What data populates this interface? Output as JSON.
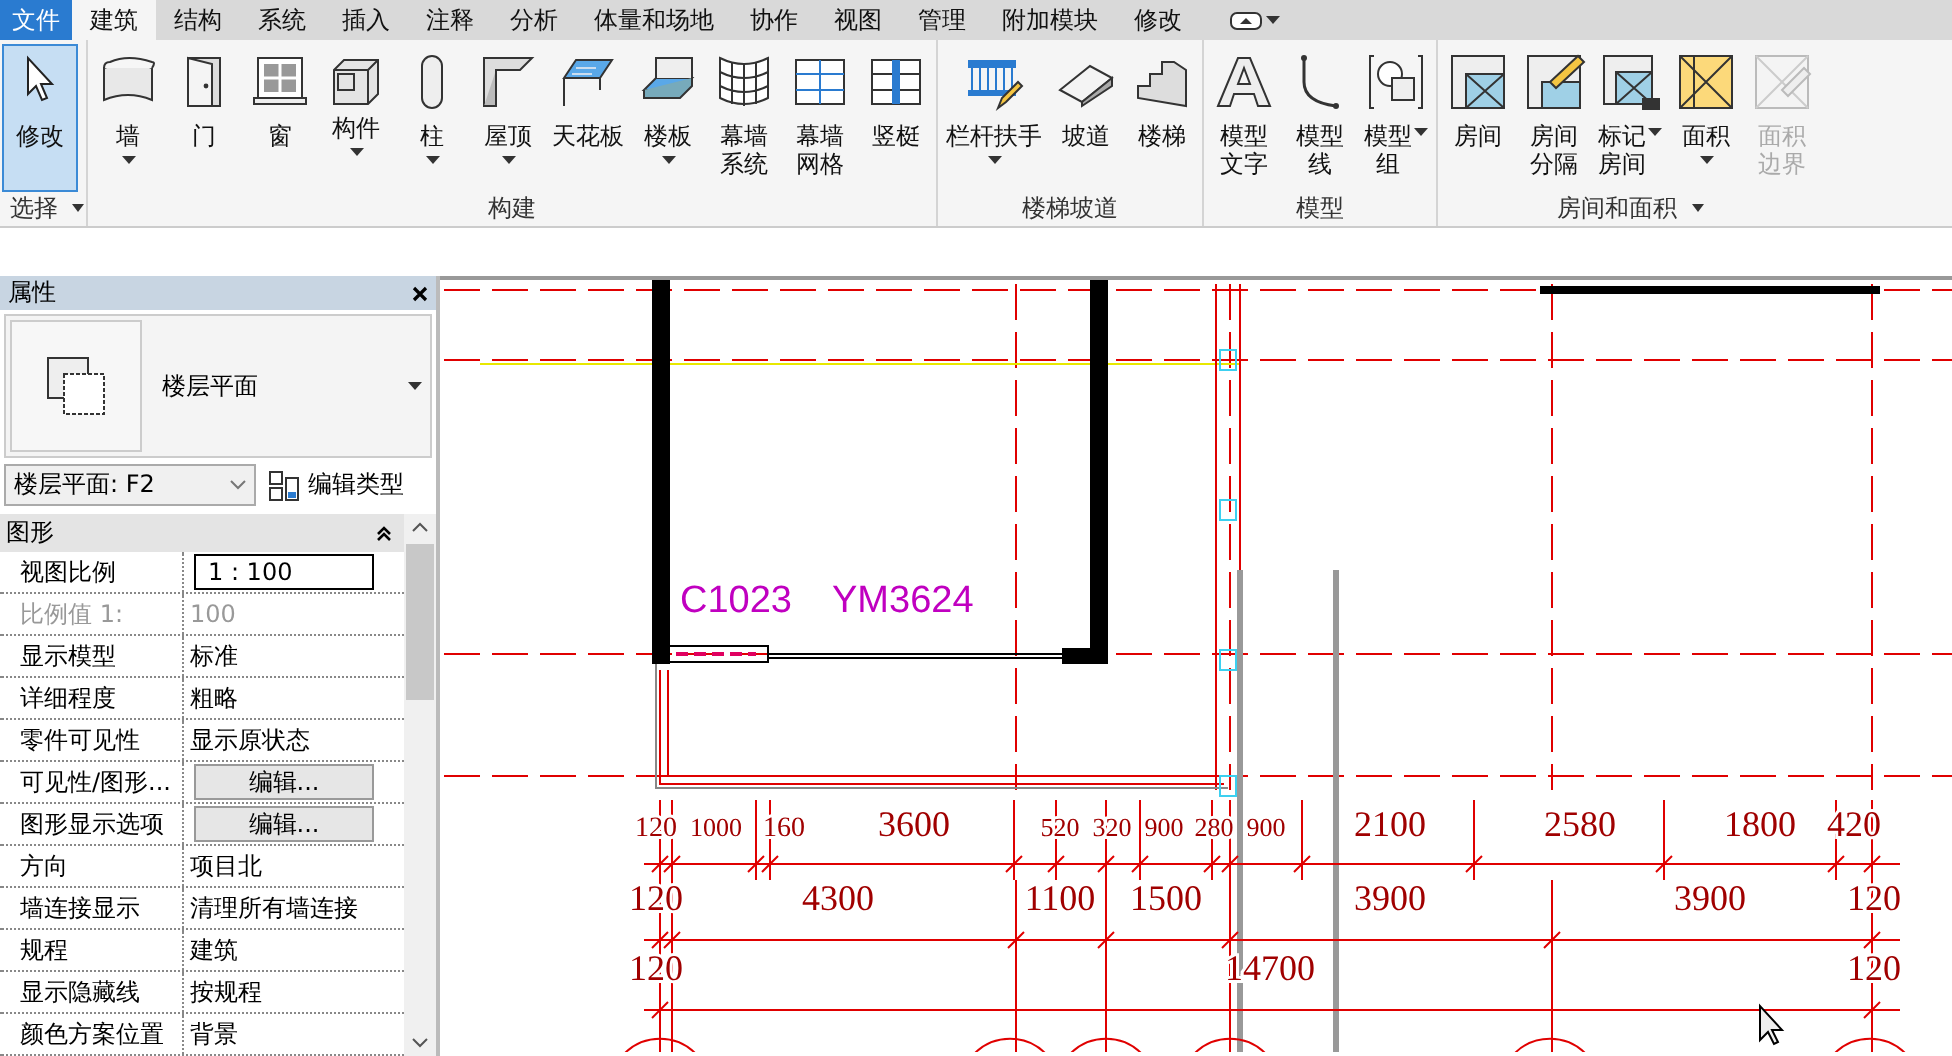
{
  "menu_tabs": [
    {
      "label": "文件",
      "kind": "app",
      "selected": false
    },
    {
      "label": "建筑",
      "kind": "tab",
      "selected": true
    },
    {
      "label": "结构",
      "kind": "tab",
      "selected": false
    },
    {
      "label": "系统",
      "kind": "tab",
      "selected": false
    },
    {
      "label": "插入",
      "kind": "tab",
      "selected": false
    },
    {
      "label": "注释",
      "kind": "tab",
      "selected": false
    },
    {
      "label": "分析",
      "kind": "tab",
      "selected": false
    },
    {
      "label": "体量和场地",
      "kind": "tab",
      "selected": false
    },
    {
      "label": "协作",
      "kind": "tab",
      "selected": false
    },
    {
      "label": "视图",
      "kind": "tab",
      "selected": false
    },
    {
      "label": "管理",
      "kind": "tab",
      "selected": false
    },
    {
      "label": "附加模块",
      "kind": "tab",
      "selected": false
    },
    {
      "label": "修改",
      "kind": "tab",
      "selected": false
    }
  ],
  "ribbon": {
    "panels": [
      {
        "title": "选择",
        "has_menu": true,
        "tools": [
          {
            "label_lines": [
              "修改"
            ],
            "dropdown": false,
            "selected": true,
            "disabled": false
          }
        ]
      },
      {
        "title": "构建",
        "has_menu": false,
        "tools": [
          {
            "label_lines": [
              "墙"
            ],
            "dropdown": true,
            "selected": false,
            "disabled": false
          },
          {
            "label_lines": [
              "门"
            ],
            "dropdown": false,
            "selected": false,
            "disabled": false
          },
          {
            "label_lines": [
              "窗"
            ],
            "dropdown": false,
            "selected": false,
            "disabled": false
          },
          {
            "label_lines": [
              "构件"
            ],
            "dropdown": true,
            "selected": false,
            "disabled": false
          },
          {
            "label_lines": [
              "柱"
            ],
            "dropdown": true,
            "selected": false,
            "disabled": false
          },
          {
            "label_lines": [
              "屋顶"
            ],
            "dropdown": true,
            "selected": false,
            "disabled": false
          },
          {
            "label_lines": [
              "天花板"
            ],
            "dropdown": false,
            "selected": false,
            "disabled": false
          },
          {
            "label_lines": [
              "楼板"
            ],
            "dropdown": true,
            "selected": false,
            "disabled": false
          },
          {
            "label_lines": [
              "幕墙",
              "系统"
            ],
            "dropdown": false,
            "selected": false,
            "disabled": false
          },
          {
            "label_lines": [
              "幕墙",
              "网格"
            ],
            "dropdown": false,
            "selected": false,
            "disabled": false
          },
          {
            "label_lines": [
              "竖梃"
            ],
            "dropdown": false,
            "selected": false,
            "disabled": false
          }
        ]
      },
      {
        "title": "楼梯坡道",
        "has_menu": false,
        "tools": [
          {
            "label_lines": [
              "栏杆扶手"
            ],
            "dropdown": true,
            "selected": false,
            "disabled": false
          },
          {
            "label_lines": [
              "坡道"
            ],
            "dropdown": false,
            "selected": false,
            "disabled": false
          },
          {
            "label_lines": [
              "楼梯"
            ],
            "dropdown": false,
            "selected": false,
            "disabled": false
          }
        ]
      },
      {
        "title": "模型",
        "has_menu": false,
        "tools": [
          {
            "label_lines": [
              "模型",
              "文字"
            ],
            "dropdown": false,
            "selected": false,
            "disabled": false
          },
          {
            "label_lines": [
              "模型",
              "线"
            ],
            "dropdown": false,
            "selected": false,
            "disabled": false
          },
          {
            "label_lines": [
              "模型",
              "组"
            ],
            "dropdown": true,
            "selected": false,
            "disabled": false
          }
        ]
      },
      {
        "title": "房间和面积",
        "has_menu": true,
        "tools": [
          {
            "label_lines": [
              "房间"
            ],
            "dropdown": false,
            "selected": false,
            "disabled": false
          },
          {
            "label_lines": [
              "房间",
              "分隔"
            ],
            "dropdown": false,
            "selected": false,
            "disabled": false
          },
          {
            "label_lines": [
              "标记",
              "房间"
            ],
            "dropdown": true,
            "selected": false,
            "disabled": false
          },
          {
            "label_lines": [
              "面积"
            ],
            "dropdown": true,
            "selected": false,
            "disabled": false
          },
          {
            "label_lines": [
              "面积",
              "边界"
            ],
            "dropdown": false,
            "selected": false,
            "disabled": true
          }
        ]
      }
    ]
  },
  "properties": {
    "title": "属性",
    "type_name": "楼层平面",
    "instance": "楼层平面: F2",
    "edit_type": "编辑类型",
    "group": {
      "title": "图形",
      "expanded": true
    },
    "rows": [
      {
        "name": "视图比例",
        "value": "1 : 100",
        "kind": "field",
        "disabled": false
      },
      {
        "name": "比例值 1:",
        "value": "100",
        "kind": "text",
        "disabled": true
      },
      {
        "name": "显示模型",
        "value": "标准",
        "kind": "text",
        "disabled": false
      },
      {
        "name": "详细程度",
        "value": "粗略",
        "kind": "text",
        "disabled": false
      },
      {
        "name": "零件可见性",
        "value": "显示原状态",
        "kind": "text",
        "disabled": false
      },
      {
        "name": "可见性/图形...",
        "value": "编辑...",
        "kind": "button",
        "disabled": false
      },
      {
        "name": "图形显示选项",
        "value": "编辑...",
        "kind": "button",
        "disabled": false
      },
      {
        "name": "方向",
        "value": "项目北",
        "kind": "text",
        "disabled": false
      },
      {
        "name": "墙连接显示",
        "value": "清理所有墙连接",
        "kind": "text",
        "disabled": false
      },
      {
        "name": "规程",
        "value": "建筑",
        "kind": "text",
        "disabled": false
      },
      {
        "name": "显示隐藏线",
        "value": "按规程",
        "kind": "text",
        "disabled": false
      },
      {
        "name": "颜色方案位置",
        "value": "背景",
        "kind": "text",
        "disabled": false
      }
    ]
  },
  "drawing": {
    "tags": [
      {
        "label": "C1023"
      },
      {
        "label": "YM3624"
      }
    ],
    "dimension_rows": [
      {
        "values": [
          "120",
          "1000",
          "160",
          "3600",
          "520",
          "320",
          "900",
          "280",
          "900",
          "2100",
          "2580",
          "1800",
          "420"
        ]
      },
      {
        "values": [
          "120",
          "4300",
          "1100",
          "1500",
          "3900",
          "3900",
          "120"
        ]
      },
      {
        "values": [
          "120",
          "14700",
          "120"
        ]
      }
    ]
  }
}
